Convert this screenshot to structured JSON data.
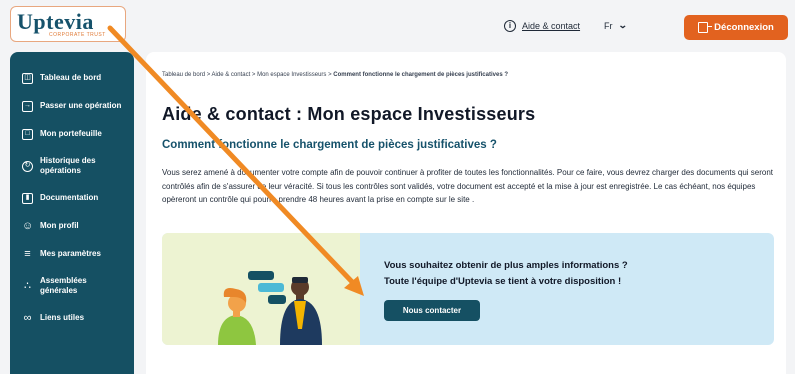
{
  "header": {
    "logo_text": "Uptevia",
    "logo_tagline": "CORPORATE TRUST",
    "help_label": "Aide & contact",
    "help_icon": "info-circle-icon",
    "language": "Fr",
    "logout_label": "Déconnexion",
    "logout_color": "#e2621f"
  },
  "sidebar": {
    "color": "#155063",
    "items": [
      {
        "label": "Tableau de bord",
        "icon": "dashboard-icon"
      },
      {
        "label": "Passer une opération",
        "icon": "operation-icon"
      },
      {
        "label": "Mon portefeuille",
        "icon": "wallet-icon"
      },
      {
        "label": "Historique des opérations",
        "icon": "history-icon"
      },
      {
        "label": "Documentation",
        "icon": "document-icon"
      },
      {
        "label": "Mon profil",
        "icon": "user-icon"
      },
      {
        "label": "Mes paramètres",
        "icon": "sliders-icon"
      },
      {
        "label": "Assemblées générales",
        "icon": "people-icon"
      },
      {
        "label": "Liens utiles",
        "icon": "link-icon"
      }
    ]
  },
  "main": {
    "breadcrumb": {
      "path": "Tableau de bord > Aide & contact > Mon espace Investisseurs > ",
      "current": "Comment fonctionne le chargement de pièces justificatives ?"
    },
    "title": "Aide & contact :  Mon espace Investisseurs",
    "subtitle": "Comment fonctionne le chargement de pièces justificatives ?",
    "paragraph": "Vous serez amené à documenter votre compte afin de pouvoir continuer à profiter de toutes les fonctionnalités. Pour ce faire, vous devrez charger des documents qui seront contrôlés afin de s'assurer de leur véracité. Si tous les contrôles sont validés, votre document est accepté et la mise à jour est enregistrée. Le cas échéant, nos équipes opèreront un contrôle qui pourra prendre 48 heures avant la prise en compte sur le site .",
    "banner": {
      "line1": "Vous souhaitez obtenir de plus amples informations ?",
      "line2": "Toute l'équipe d'Uptevia se tient à votre disposition !",
      "button_label": "Nous contacter"
    }
  },
  "annotation": {
    "arrow_color": "#f08a24"
  }
}
